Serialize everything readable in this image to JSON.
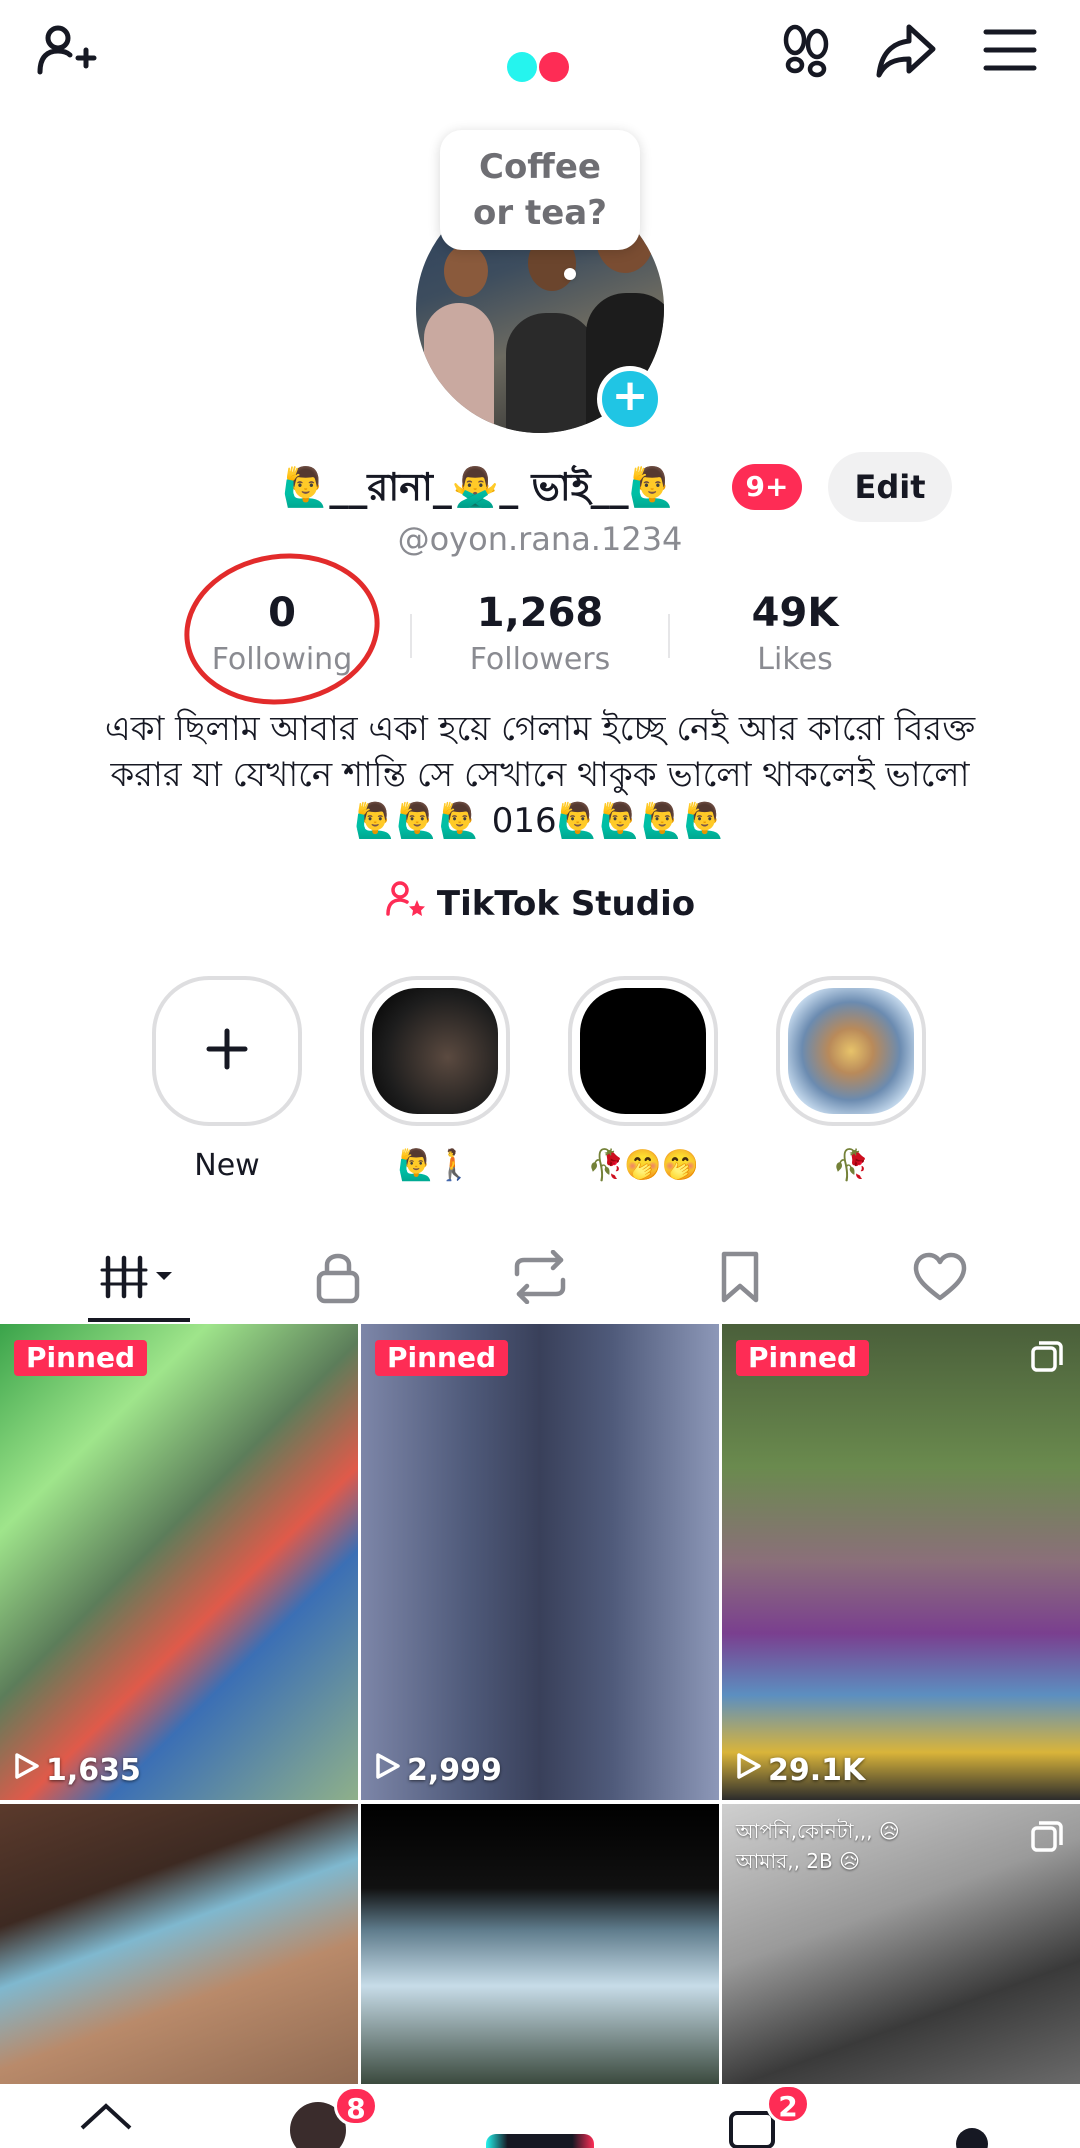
{
  "profile": {
    "name_prompt": "Coffee or tea?",
    "display_name": "🙋‍♂️__রানা_🙅‍♂️_ ভাই__🙋‍♂️",
    "notification_count": "9+",
    "edit_label": "Edit",
    "handle": "@oyon.rana.1234"
  },
  "stats": [
    {
      "value": "0",
      "label": "Following"
    },
    {
      "value": "1,268",
      "label": "Followers"
    },
    {
      "value": "49K",
      "label": "Likes"
    }
  ],
  "bio": "একা ছিলাম আবার একা হয়ে গেলাম ইচ্ছে নেই আর কারো বিরক্ত করার যা যেখানে শান্তি সে সেখানে থাকুক   ভালো থাকলেই ভালো🙋‍♂️🙋‍♂️🙋‍♂️ 016🙋‍♂️🙋‍♂️🙋‍♂️🙋‍♂️",
  "studio_label": "TikTok Studio",
  "highlights": [
    {
      "label": "New"
    },
    {
      "label": "🙋‍♂️🚶"
    },
    {
      "label": "🥀🤭🤭"
    },
    {
      "label": "🥀"
    }
  ],
  "videos": [
    {
      "badge": "Pinned",
      "views": "1,635"
    },
    {
      "badge": "Pinned",
      "views": "2,999"
    },
    {
      "badge": "Pinned",
      "views": "29.1K"
    },
    {
      "badge": "",
      "views": ""
    },
    {
      "badge": "",
      "views": ""
    },
    {
      "badge": "",
      "views": "",
      "overlay_text": "আপনি,কোনটা,,, 😥\nআমার,, 2B 😥"
    }
  ],
  "nav": {
    "friends_badge": "8",
    "inbox_badge": "2"
  },
  "colors": {
    "accent": "#fe2c55",
    "add_button": "#20c5e4",
    "annotation_circle": "#e22b2b"
  }
}
